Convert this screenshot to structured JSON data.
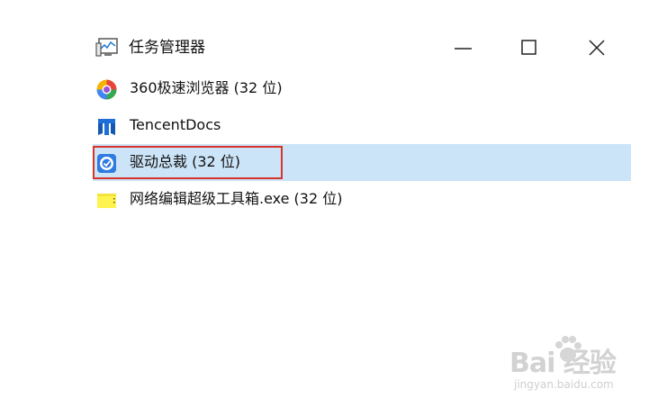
{
  "window": {
    "title": "任务管理器",
    "title_icon": "task-manager-icon",
    "controls": {
      "minimize_icon": "minimize-icon",
      "maximize_icon": "maximize-icon",
      "close_icon": "close-icon"
    }
  },
  "processes": [
    {
      "label": "360极速浏览器 (32 位)",
      "icon": "360-browser-icon"
    },
    {
      "label": "TencentDocs",
      "icon": "tencent-docs-icon"
    },
    {
      "label": "驱动总裁 (32 位)",
      "icon": "driver-manager-icon",
      "selected": true,
      "highlighted": true
    },
    {
      "label": "网络编辑超级工具箱.exe (32 位)",
      "icon": "notepad-file-icon"
    }
  ],
  "colors": {
    "selection": "#cce4f7",
    "highlight_border": "#d9342b"
  },
  "watermark": {
    "brand": "Bai  经验",
    "url": "jingyan.baidu.com"
  }
}
